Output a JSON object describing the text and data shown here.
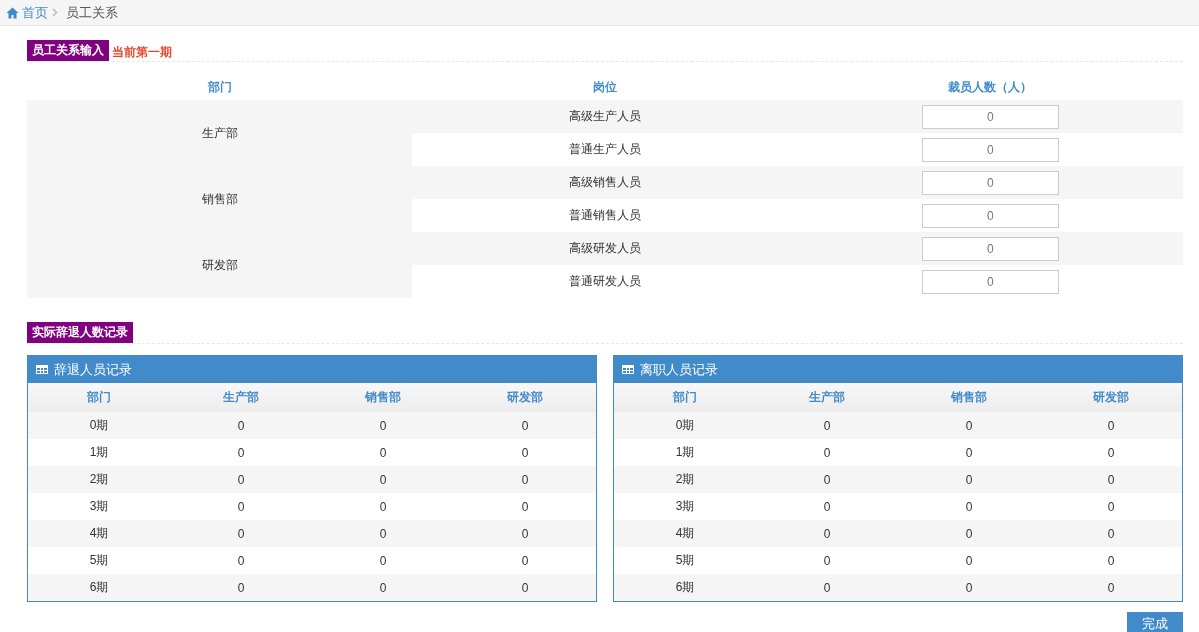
{
  "breadcrumb": {
    "home": "首页",
    "current": "员工关系"
  },
  "input_section": {
    "title": "员工关系输入",
    "period": "当前第一期",
    "columns": [
      "部门",
      "岗位",
      "裁员人数（人）"
    ],
    "departments": [
      {
        "name": "生产部",
        "positions": [
          {
            "name": "高级生产人员",
            "value": "0"
          },
          {
            "name": "普通生产人员",
            "value": "0"
          }
        ]
      },
      {
        "name": "销售部",
        "positions": [
          {
            "name": "高级销售人员",
            "value": "0"
          },
          {
            "name": "普通销售人员",
            "value": "0"
          }
        ]
      },
      {
        "name": "研发部",
        "positions": [
          {
            "name": "高级研发人员",
            "value": "0"
          },
          {
            "name": "普通研发人员",
            "value": "0"
          }
        ]
      }
    ]
  },
  "record_section": {
    "title": "实际辞退人数记录",
    "panels": [
      {
        "title": "辞退人员记录",
        "columns": [
          "部门",
          "生产部",
          "销售部",
          "研发部"
        ],
        "rows": [
          [
            "0期",
            "0",
            "0",
            "0"
          ],
          [
            "1期",
            "0",
            "0",
            "0"
          ],
          [
            "2期",
            "0",
            "0",
            "0"
          ],
          [
            "3期",
            "0",
            "0",
            "0"
          ],
          [
            "4期",
            "0",
            "0",
            "0"
          ],
          [
            "5期",
            "0",
            "0",
            "0"
          ],
          [
            "6期",
            "0",
            "0",
            "0"
          ]
        ]
      },
      {
        "title": "离职人员记录",
        "columns": [
          "部门",
          "生产部",
          "销售部",
          "研发部"
        ],
        "rows": [
          [
            "0期",
            "0",
            "0",
            "0"
          ],
          [
            "1期",
            "0",
            "0",
            "0"
          ],
          [
            "2期",
            "0",
            "0",
            "0"
          ],
          [
            "3期",
            "0",
            "0",
            "0"
          ],
          [
            "4期",
            "0",
            "0",
            "0"
          ],
          [
            "5期",
            "0",
            "0",
            "0"
          ],
          [
            "6期",
            "0",
            "0",
            "0"
          ]
        ]
      }
    ]
  },
  "done_button": "完成"
}
